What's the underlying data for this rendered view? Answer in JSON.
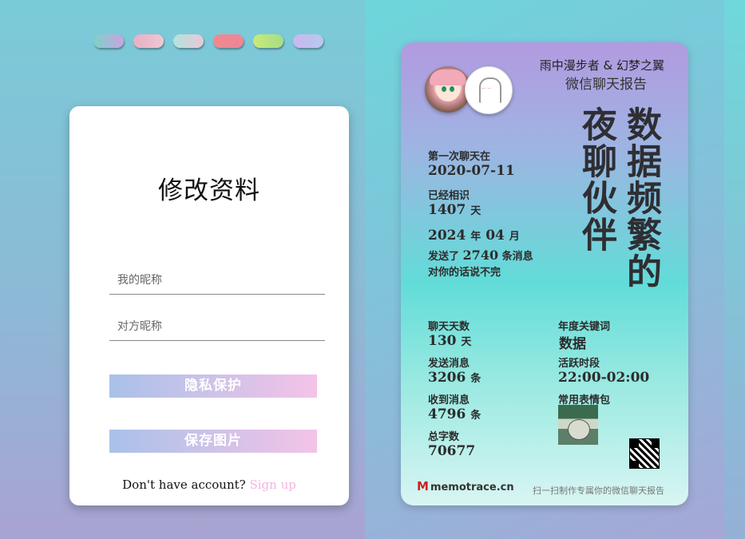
{
  "theme_pills": [
    {
      "colors": [
        "#7fd0c8",
        "#c7a5e2"
      ]
    },
    {
      "colors": [
        "#e7b0c4",
        "#f0c7d2"
      ]
    },
    {
      "colors": [
        "#b3e3dc",
        "#e9c7d9"
      ]
    },
    {
      "colors": [
        "#ee8a8e",
        "#f08597"
      ]
    },
    {
      "colors": [
        "#c8ea7a",
        "#a7dd86"
      ]
    },
    {
      "colors": [
        "#c8b8ee",
        "#b9c7f0"
      ]
    }
  ],
  "form": {
    "title": "修改资料",
    "my_nickname_placeholder": "我的昵称",
    "other_nickname_placeholder": "对方昵称",
    "privacy_label": "隐私保护",
    "save_label": "保存图片",
    "account_prompt": "Don't have account?",
    "signup_label": "Sign up"
  },
  "report": {
    "names": "雨中漫步者 & 幻梦之翼",
    "title": "微信聊天报告",
    "headline_col1": "数据频繁的",
    "headline_col2": "夜聊伙伴",
    "first_chat_label": "第一次聊天在",
    "first_chat_date": "2020-07-11",
    "known_label": "已经相识",
    "known_days": "1407",
    "known_unit": "天",
    "year": "2024",
    "year_unit": "年",
    "month": "04",
    "month_unit": "月",
    "sent_prefix": "发送了",
    "sent_count": "2740",
    "sent_suffix": "条消息",
    "endless_text": "对你的话说不完",
    "chat_days_label": "聊天天数",
    "chat_days": "130",
    "chat_days_unit": "天",
    "sent_msgs_label": "发送消息",
    "sent_msgs": "3206",
    "sent_msgs_unit": "条",
    "recv_msgs_label": "收到消息",
    "recv_msgs": "4796",
    "recv_msgs_unit": "条",
    "total_chars_label": "总字数",
    "total_chars": "70677",
    "keyword_label": "年度关键词",
    "keyword": "数据",
    "active_label": "活跃时段",
    "active_period": "22:00-02:00",
    "sticker_label": "常用表情包",
    "logo_mark": "M",
    "logo_text": "memotrace.cn",
    "footer_note": "扫一扫制作专属你的微信聊天报告"
  }
}
